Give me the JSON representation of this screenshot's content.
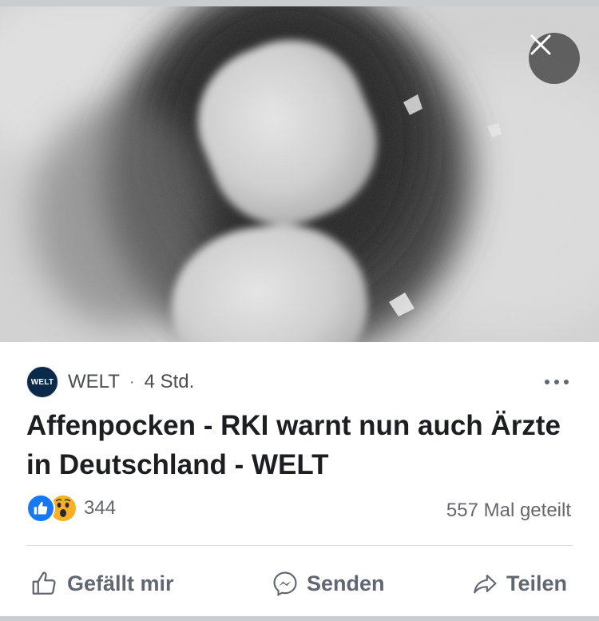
{
  "post": {
    "source_name": "WELT",
    "avatar_text": "WELT",
    "separator": "·",
    "timestamp": "4 Std.",
    "title": "Affenpocken - RKI warnt nun auch Ärzte in Deutschland - WELT",
    "reaction_count": "344",
    "share_count": "557 Mal geteilt",
    "reactions": [
      "like",
      "wow"
    ]
  },
  "actions": {
    "like_label": "Gefällt mir",
    "send_label": "Senden",
    "share_label": "Teilen"
  },
  "media": {
    "subject": "electron-micrograph-virus-particles",
    "close_icon": "close-icon"
  },
  "colors": {
    "brand_blue": "#1877f2",
    "wow_yellow": "#f7b125",
    "text_secondary": "#65676b",
    "text_primary": "#1c1e21"
  }
}
